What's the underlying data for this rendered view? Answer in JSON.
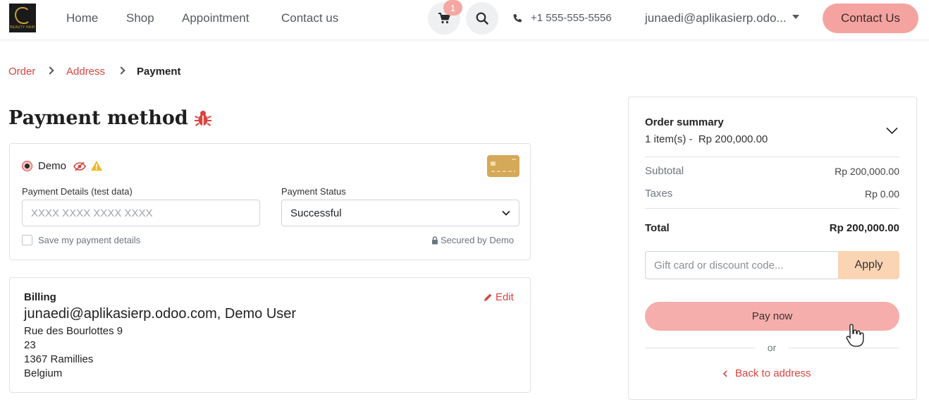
{
  "header": {
    "logo_text": "BEAUTY HAIR",
    "nav": [
      "Home",
      "Shop",
      "Appointment",
      "Contact us"
    ],
    "cart_count": "1",
    "phone": "+1 555-555-5556",
    "user": "junaedi@aplikasierp.odo...",
    "contact_button": "Contact Us"
  },
  "breadcrumb": {
    "order": "Order",
    "address": "Address",
    "payment": "Payment"
  },
  "payment": {
    "title": "Payment method",
    "provider_name": "Demo",
    "details_label": "Payment Details (test data)",
    "card_placeholder": "XXXX XXXX XXXX XXXX",
    "status_label": "Payment Status",
    "status_value": "Successful",
    "save_label": "Save my payment details",
    "secured_text": "Secured by Demo"
  },
  "billing": {
    "heading": "Billing",
    "edit": "Edit",
    "name_line": "junaedi@aplikasierp.odoo.com, Demo User",
    "street": "Rue des Bourlottes 9",
    "street2": "23",
    "city": "1367 Ramillies",
    "country": "Belgium"
  },
  "summary": {
    "title": "Order summary",
    "items_line": "1 item(s) -  Rp 200,000.00",
    "subtotal_label": "Subtotal",
    "subtotal_value": "Rp 200,000.00",
    "taxes_label": "Taxes",
    "taxes_value": "Rp 0.00",
    "total_label": "Total",
    "total_value": "Rp 200,000.00",
    "discount_placeholder": "Gift card or discount code...",
    "apply": "Apply",
    "pay_now": "Pay now",
    "or": "or",
    "back": "Back to address"
  },
  "colors": {
    "accent": "#d9443f",
    "button_pink": "#f5a3a0",
    "apply_peach": "#fbd4b4"
  }
}
